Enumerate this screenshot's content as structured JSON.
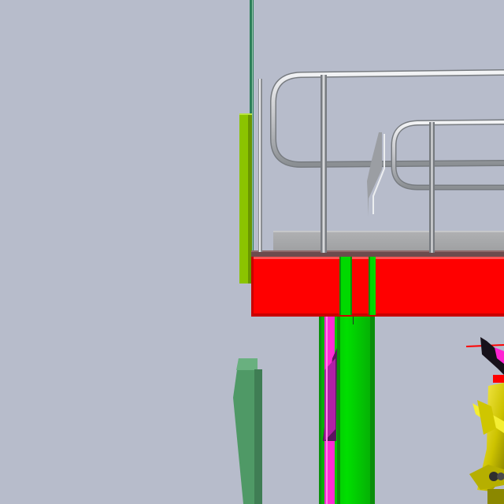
{
  "colors": {
    "background": "#b7bccb",
    "rail": "#c7c9cd",
    "rail_shadow": "#8f9296",
    "deck": "#a4a5a7",
    "deck_edge": "#6d4b4d",
    "beam_red": "#ff0000",
    "beam_red_dark": "#c90000",
    "column_green": "#00d900",
    "column_green_dark": "#0b8f0b",
    "brace_magenta": "#ff2bd5",
    "brace_purple": "#5a145d",
    "side_plate_lime": "#8bc400",
    "post_teal": "#2d7f5a",
    "block_green": "#4f9966",
    "machine_yellow": "#d5cf00",
    "machine_yellow_dark": "#8b8800",
    "machine_black": "#17111a",
    "machine_red": "#ff0000",
    "machine_magenta": "#ff24d2"
  },
  "icons": {
    "handrail": "handrail-icon",
    "platform": "platform-icon",
    "machine": "yellow-machine-icon"
  }
}
